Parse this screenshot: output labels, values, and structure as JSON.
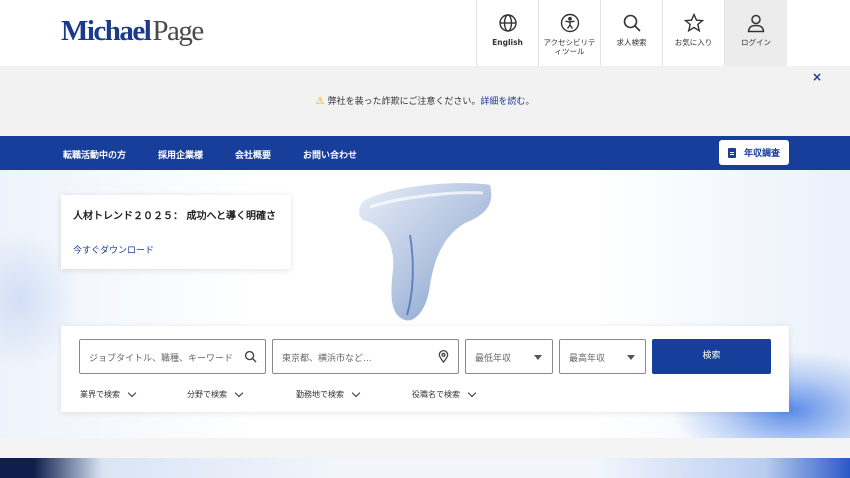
{
  "header": {
    "logo_michael": "Michael",
    "logo_page": "Page",
    "nav": [
      {
        "label": "English",
        "icon": "globe-icon"
      },
      {
        "label": "アクセシビリテ\nィツール",
        "icon": "accessibility-icon"
      },
      {
        "label": "求人検索",
        "icon": "search-icon"
      },
      {
        "label": "お気に入り",
        "icon": "star-icon"
      },
      {
        "label": "ログイン",
        "icon": "user-icon"
      }
    ]
  },
  "notice": {
    "icon": "warning-icon",
    "text": "弊社を装った詐欺にご注意ください。",
    "link": "詳細を読む。",
    "close": "×"
  },
  "mainnav": {
    "items": [
      "転職活動中の方",
      "採用企業様",
      "会社概要",
      "お問い合わせ"
    ],
    "salary_button": "年収調査"
  },
  "promo": {
    "title": "人材トレンド２０２５： 成功へと導く明確さ",
    "link": "今すぐダウンロード"
  },
  "search": {
    "keyword_placeholder": "ジョブタイトル、職種、キーワード",
    "location_placeholder": "東京都、横浜市など...",
    "min_salary": "最低年収",
    "max_salary": "最高年収",
    "submit": "検索",
    "filters": [
      "業界で検索",
      "分野で検索",
      "勤務地で検索",
      "役職名で検索"
    ]
  },
  "colors": {
    "brand_blue": "#173e9a",
    "logo_blue": "#1b3a8c",
    "warning": "#e0a400"
  }
}
